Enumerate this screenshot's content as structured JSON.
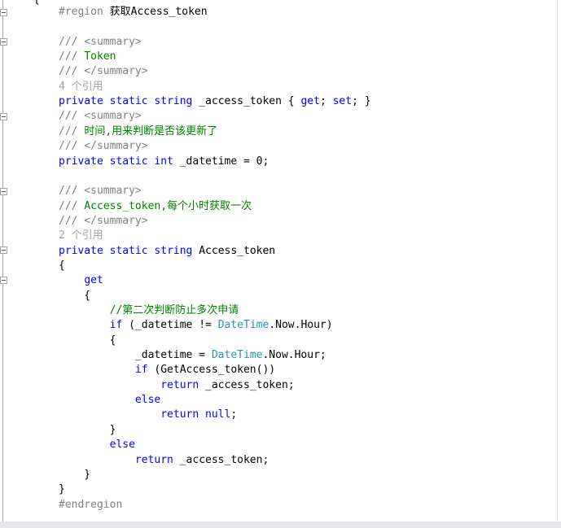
{
  "colors": {
    "keyword": "#0000ff",
    "comment": "#008000",
    "type": "#2b91af",
    "preprocessor": "#808080",
    "reference_hint": "#a0a0a0",
    "text": "#000000"
  },
  "editor": {
    "top_brace": "{",
    "lines": [
      [
        {
          "t": "#region",
          "c": "pp"
        },
        {
          "t": " 获取Access_token",
          "c": "txt"
        }
      ],
      [],
      [
        {
          "t": "/// <summary>",
          "c": "pp"
        }
      ],
      [
        {
          "t": "/// ",
          "c": "pp"
        },
        {
          "t": "Token",
          "c": "cm"
        }
      ],
      [
        {
          "t": "/// </summary>",
          "c": "pp"
        }
      ],
      [
        {
          "t": "4 个引用",
          "c": "ref"
        }
      ],
      [
        {
          "t": "private",
          "c": "kw"
        },
        {
          "t": " ",
          "c": "txt"
        },
        {
          "t": "static",
          "c": "kw"
        },
        {
          "t": " ",
          "c": "txt"
        },
        {
          "t": "string",
          "c": "kw"
        },
        {
          "t": " _access_token { ",
          "c": "txt"
        },
        {
          "t": "get",
          "c": "kw"
        },
        {
          "t": "; ",
          "c": "txt"
        },
        {
          "t": "set",
          "c": "kw"
        },
        {
          "t": "; }",
          "c": "txt"
        }
      ],
      [
        {
          "t": "/// <summary>",
          "c": "pp"
        }
      ],
      [
        {
          "t": "/// ",
          "c": "pp"
        },
        {
          "t": "时间,用来判断是否该更新了",
          "c": "cm"
        }
      ],
      [
        {
          "t": "/// </summary>",
          "c": "pp"
        }
      ],
      [
        {
          "t": "private",
          "c": "kw"
        },
        {
          "t": " ",
          "c": "txt"
        },
        {
          "t": "static",
          "c": "kw"
        },
        {
          "t": " ",
          "c": "txt"
        },
        {
          "t": "int",
          "c": "kw"
        },
        {
          "t": " _datetime = 0;",
          "c": "txt"
        }
      ],
      [],
      [
        {
          "t": "/// <summary>",
          "c": "pp"
        }
      ],
      [
        {
          "t": "/// ",
          "c": "pp"
        },
        {
          "t": "Access_token,每个小时获取一次",
          "c": "cm"
        }
      ],
      [
        {
          "t": "/// </summary>",
          "c": "pp"
        }
      ],
      [
        {
          "t": "2 个引用",
          "c": "ref"
        }
      ],
      [
        {
          "t": "private",
          "c": "kw"
        },
        {
          "t": " ",
          "c": "txt"
        },
        {
          "t": "static",
          "c": "kw"
        },
        {
          "t": " ",
          "c": "txt"
        },
        {
          "t": "string",
          "c": "kw"
        },
        {
          "t": " Access_token",
          "c": "txt"
        }
      ],
      [
        {
          "t": "{",
          "c": "txt"
        }
      ],
      [
        {
          "t": "    ",
          "c": "txt"
        },
        {
          "t": "get",
          "c": "kw"
        }
      ],
      [
        {
          "t": "    {",
          "c": "txt"
        }
      ],
      [
        {
          "t": "        ",
          "c": "txt"
        },
        {
          "t": "//第二次判断防止多次申请",
          "c": "cm"
        }
      ],
      [
        {
          "t": "        ",
          "c": "txt"
        },
        {
          "t": "if",
          "c": "kw"
        },
        {
          "t": " (_datetime != ",
          "c": "txt"
        },
        {
          "t": "DateTime",
          "c": "ty"
        },
        {
          "t": ".Now.Hour)",
          "c": "txt"
        }
      ],
      [
        {
          "t": "        {",
          "c": "txt"
        }
      ],
      [
        {
          "t": "            _datetime = ",
          "c": "txt"
        },
        {
          "t": "DateTime",
          "c": "ty"
        },
        {
          "t": ".Now.Hour;",
          "c": "txt"
        }
      ],
      [
        {
          "t": "            ",
          "c": "txt"
        },
        {
          "t": "if",
          "c": "kw"
        },
        {
          "t": " (GetAccess_token())",
          "c": "txt"
        }
      ],
      [
        {
          "t": "                ",
          "c": "txt"
        },
        {
          "t": "return",
          "c": "kw"
        },
        {
          "t": " _access_token;",
          "c": "txt"
        }
      ],
      [
        {
          "t": "            ",
          "c": "txt"
        },
        {
          "t": "else",
          "c": "kw"
        }
      ],
      [
        {
          "t": "                ",
          "c": "txt"
        },
        {
          "t": "return",
          "c": "kw"
        },
        {
          "t": " ",
          "c": "txt"
        },
        {
          "t": "null",
          "c": "kw"
        },
        {
          "t": ";",
          "c": "txt"
        }
      ],
      [
        {
          "t": "        }",
          "c": "txt"
        }
      ],
      [
        {
          "t": "        ",
          "c": "txt"
        },
        {
          "t": "else",
          "c": "kw"
        }
      ],
      [
        {
          "t": "            ",
          "c": "txt"
        },
        {
          "t": "return",
          "c": "kw"
        },
        {
          "t": " _access_token;",
          "c": "txt"
        }
      ],
      [
        {
          "t": "    }",
          "c": "txt"
        }
      ],
      [
        {
          "t": "}",
          "c": "txt"
        }
      ],
      [
        {
          "t": "#endregion",
          "c": "pp"
        }
      ]
    ]
  }
}
